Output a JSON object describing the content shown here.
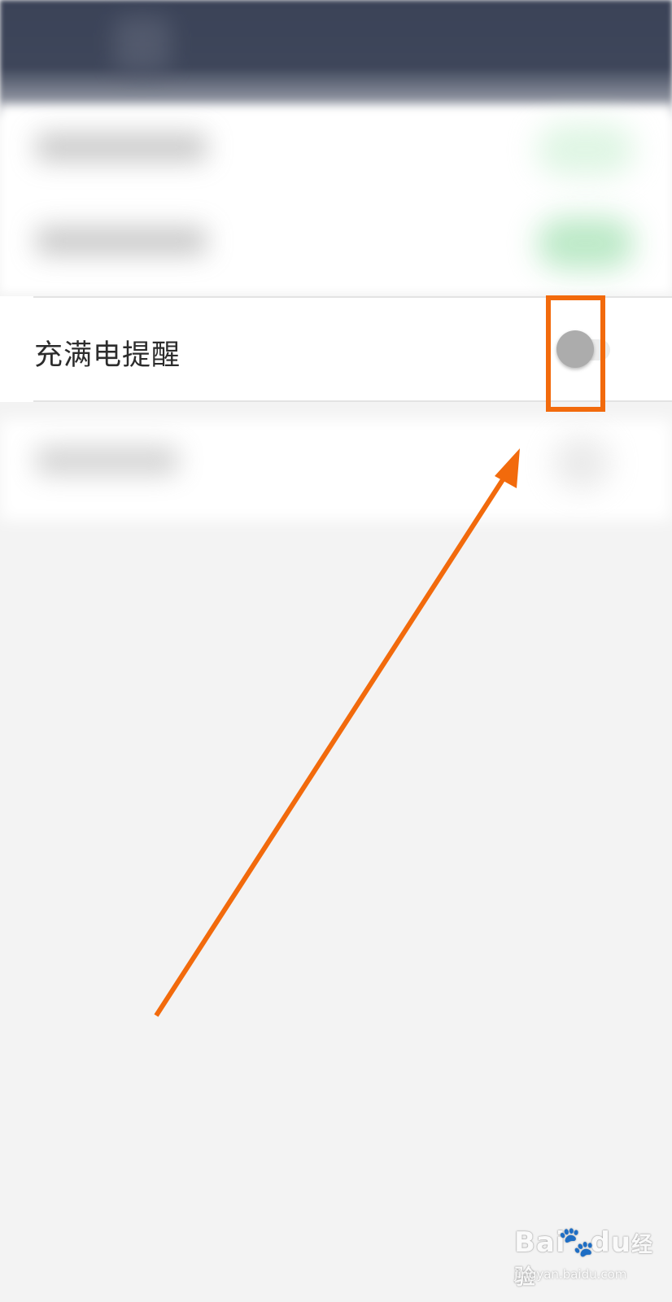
{
  "settings": {
    "charge_full_reminder": {
      "label": "充满电提醒",
      "toggle_on": false
    }
  },
  "annotation": {
    "highlight_color": "#f26a0c",
    "arrow_color": "#f26a0c"
  },
  "watermark": {
    "logo_text": "Bai",
    "logo_suffix": "du",
    "brand_cn": "经验",
    "url": "jingyan.baidu.com"
  },
  "colors": {
    "header": "#3b4358",
    "background": "#f3f3f3",
    "toggle_knob_off": "#acacac",
    "blurred_toggle_on": "#b8e8c4"
  }
}
